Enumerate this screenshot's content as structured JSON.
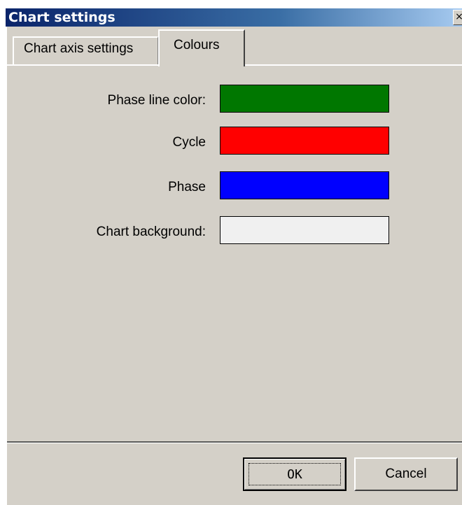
{
  "window": {
    "title": "Chart settings",
    "close_glyph": "×"
  },
  "tabs": [
    {
      "label": "Chart axis settings",
      "active": false
    },
    {
      "label": "Colours",
      "active": true
    }
  ],
  "colours": [
    {
      "label": "Phase line color:",
      "color": "#007700"
    },
    {
      "label": "Cycle",
      "color": "#ff0000"
    },
    {
      "label": "Phase",
      "color": "#0000ff"
    },
    {
      "label": "Chart background:",
      "color": "#f0f0f0"
    }
  ],
  "buttons": {
    "ok_label": "OK",
    "cancel_label": "Cancel"
  }
}
